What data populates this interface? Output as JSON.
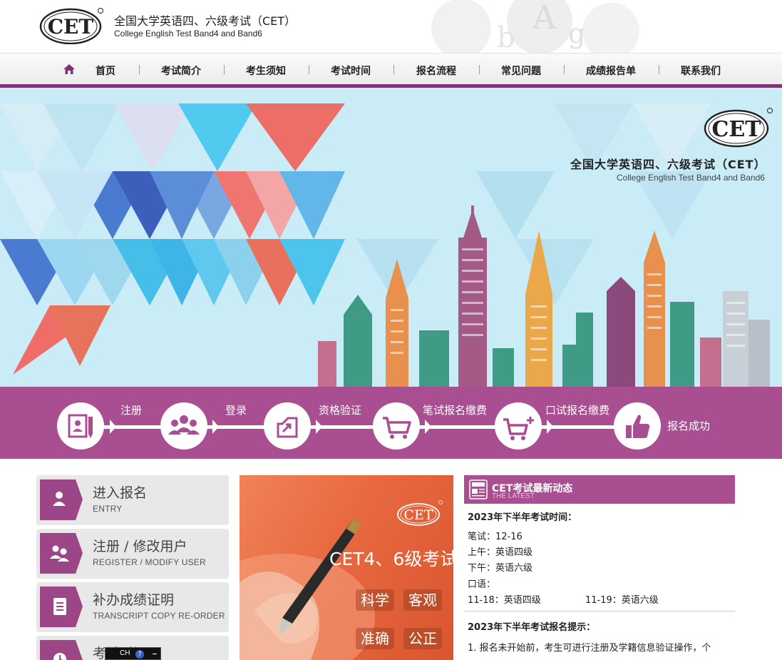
{
  "header": {
    "logo_text": "CET",
    "title": "全国大学英语四、六级考试（CET）",
    "subtitle": "College English Test Band4 and Band6"
  },
  "nav": {
    "items": [
      {
        "label": "首页"
      },
      {
        "label": "考试简介"
      },
      {
        "label": "考生须知"
      },
      {
        "label": "考试时间"
      },
      {
        "label": "报名流程"
      },
      {
        "label": "常见问题"
      },
      {
        "label": "成绩报告单"
      },
      {
        "label": "联系我们"
      }
    ]
  },
  "banner": {
    "logo_text": "CET",
    "title": "全国大学英语四、六级考试（CET）",
    "subtitle": "College English Test Band4 and Band6"
  },
  "steps": [
    {
      "label": "注册",
      "icon": "register-icon"
    },
    {
      "label": "登录",
      "icon": "users-icon"
    },
    {
      "label": "资格验证",
      "icon": "verify-icon"
    },
    {
      "label": "笔试报名缴费",
      "icon": "cart-icon"
    },
    {
      "label": "口试报名缴费",
      "icon": "cart-plus-icon"
    },
    {
      "label": "报名成功",
      "icon": "thumbs-up-icon"
    }
  ],
  "sidebar": {
    "items": [
      {
        "title": "进入报名",
        "subtitle": "ENTRY",
        "icon": "user-icon"
      },
      {
        "title": "注册 / 修改用户",
        "subtitle": "REGISTER / MODIFY USER",
        "icon": "users-icon"
      },
      {
        "title": "补办成绩证明",
        "subtitle": "TRANSCRIPT COPY RE-ORDER",
        "icon": "document-icon"
      },
      {
        "title": "考试时间",
        "subtitle": "",
        "icon": "clock-icon"
      }
    ]
  },
  "promo": {
    "logo_text": "CET",
    "heading": "CET4、6级考试",
    "tags": [
      "科学",
      "客观",
      "准确",
      "公正"
    ]
  },
  "news": {
    "title": "CET考试最新动态",
    "subtitle": "THE LATEST",
    "section1_heading": "2023年下半年考试时间：",
    "written_exam": "笔试：12-16",
    "morning": "上午：英语四级",
    "afternoon": "下午：英语六级",
    "oral_exam": "口语：",
    "oral_cet4": "11-18：英语四级",
    "oral_cet6": "11-19：英语六级",
    "section2_heading": "2023年下半年考试报名提示：",
    "tip1": "1. 报名未开始前，考生可进行注册及学籍信息验证操作，个"
  },
  "ime": {
    "text": "CH",
    "help": "?"
  },
  "colors": {
    "brand_purple": "#a84e91",
    "nav_bar": "#7d3474",
    "banner_sky": "#c9ecf7"
  }
}
